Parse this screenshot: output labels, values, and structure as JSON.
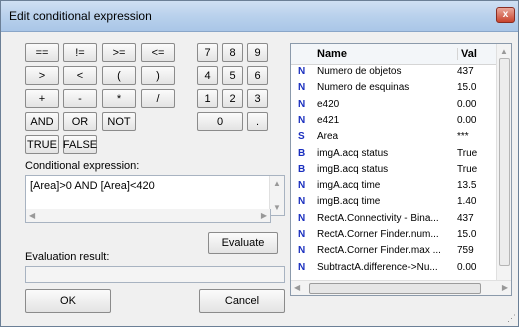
{
  "window": {
    "title": "Edit conditional expression",
    "close_label": "x"
  },
  "operators": [
    "==",
    "!=",
    ">=",
    "<=",
    ">",
    "<",
    "(",
    ")",
    "+",
    "-",
    "*",
    "/",
    "AND",
    "OR",
    "NOT",
    "TRUE",
    "FALSE"
  ],
  "digits": [
    "7",
    "8",
    "9",
    "4",
    "5",
    "6",
    "1",
    "2",
    "3",
    "0",
    "."
  ],
  "expression": {
    "label": "Conditional expression:",
    "value": "[Area]>0 AND [Area]<420"
  },
  "evaluate_label": "Evaluate",
  "evaluation": {
    "label": "Evaluation result:",
    "value": ""
  },
  "ok_label": "OK",
  "cancel_label": "Cancel",
  "variables": {
    "headers": {
      "name": "Name",
      "value": "Val"
    },
    "rows": [
      {
        "type": "N",
        "name": "Numero de objetos",
        "value": "437"
      },
      {
        "type": "N",
        "name": "Numero de esquinas",
        "value": "15.0"
      },
      {
        "type": "N",
        "name": "e420",
        "value": "0.00"
      },
      {
        "type": "N",
        "name": "e421",
        "value": "0.00"
      },
      {
        "type": "S",
        "name": "Area",
        "value": "***"
      },
      {
        "type": "B",
        "name": "imgA.acq status",
        "value": "True"
      },
      {
        "type": "B",
        "name": "imgB.acq status",
        "value": "True"
      },
      {
        "type": "N",
        "name": "imgA.acq time",
        "value": "13.5"
      },
      {
        "type": "N",
        "name": "imgB.acq time",
        "value": "1.40"
      },
      {
        "type": "N",
        "name": "RectA.Connectivity - Bina...",
        "value": "437"
      },
      {
        "type": "N",
        "name": "RectA.Corner Finder.num...",
        "value": "15.0"
      },
      {
        "type": "N",
        "name": "RectA.Corner Finder.max ...",
        "value": "759"
      },
      {
        "type": "N",
        "name": "SubtractA.difference->Nu...",
        "value": "0.00"
      }
    ]
  },
  "colors": {
    "type_marker": "#1a2fbf",
    "titlebar": "#b9d1ec"
  }
}
